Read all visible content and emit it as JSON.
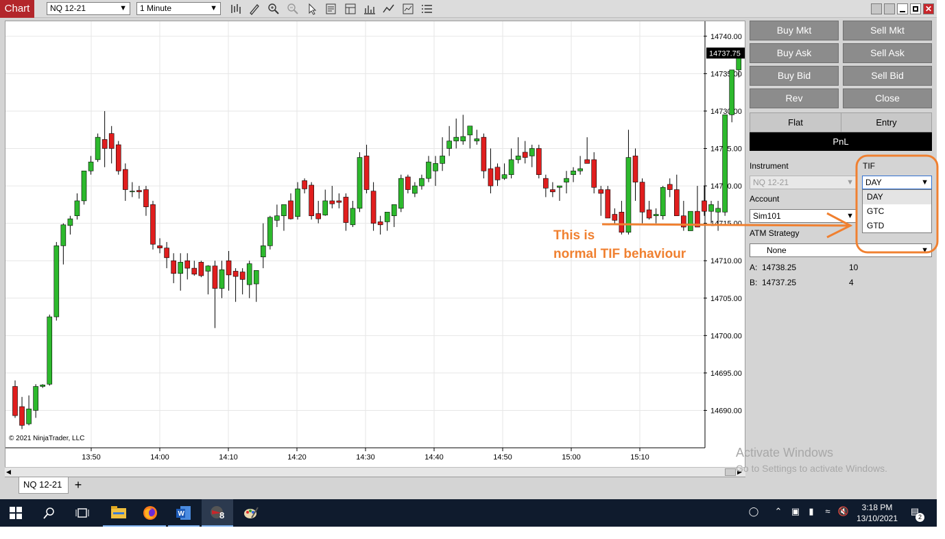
{
  "toolbar": {
    "tab_label": "Chart",
    "instrument": "NQ 12-21",
    "interval": "1 Minute",
    "icons": [
      "bar-type-icon",
      "drawing-tool-icon",
      "zoom-in-icon",
      "zoom-out-icon",
      "pointer-icon",
      "data-box-icon",
      "properties-icon",
      "chart-trader-icon",
      "indicators-icon",
      "strategies-icon",
      "menu-icon"
    ]
  },
  "chart_data": {
    "type": "candlestick",
    "instrument": "NQ 12-21",
    "price_ticks": [
      "14740.00",
      "14735.00",
      "14730.00",
      "14725.00",
      "14720.00",
      "14715.00",
      "14710.00",
      "14705.00",
      "14700.00",
      "14695.00",
      "14690.00"
    ],
    "time_ticks": [
      "13:50",
      "14:00",
      "14:10",
      "14:20",
      "14:30",
      "14:40",
      "14:50",
      "15:00",
      "15:10"
    ],
    "last_price": "14737.75",
    "ylim": [
      14685,
      14742
    ],
    "up_color": "#2db92d",
    "down_color": "#e01e1e",
    "grid": true,
    "candles": [
      [
        14693.2,
        14694.0,
        14689.0,
        14689.3
      ],
      [
        14690.5,
        14691.8,
        14687.5,
        14688.0
      ],
      [
        14688.2,
        14692.0,
        14688.0,
        14690.2
      ],
      [
        14690.0,
        14693.5,
        14689.0,
        14693.2
      ],
      [
        14693.2,
        14693.5,
        14693.0,
        14693.4
      ],
      [
        14693.5,
        14702.8,
        14693.3,
        14702.5
      ],
      [
        14702.5,
        14712.5,
        14702.0,
        14712.0
      ],
      [
        14712.0,
        14715.0,
        14709.5,
        14714.8
      ],
      [
        14714.7,
        14716.0,
        14713.5,
        14715.6
      ],
      [
        14716.0,
        14719.0,
        14715.5,
        14718.0
      ],
      [
        14718.0,
        14722.0,
        14717.5,
        14722.0
      ],
      [
        14722.0,
        14724.0,
        14721.5,
        14723.2
      ],
      [
        14723.5,
        14727.0,
        14723.2,
        14726.5
      ],
      [
        14726.2,
        14730.0,
        14722.5,
        14725.0
      ],
      [
        14727.0,
        14728.0,
        14723.0,
        14725.0
      ],
      [
        14725.5,
        14726.0,
        14721.5,
        14722.0
      ],
      [
        14722.2,
        14723.0,
        14718.0,
        14719.5
      ],
      [
        14719.2,
        14720.5,
        14718.5,
        14719.3
      ],
      [
        14719.4,
        14720.0,
        14718.3,
        14719.2
      ],
      [
        14719.5,
        14720.0,
        14716.0,
        14717.2
      ],
      [
        14717.5,
        14718.0,
        14711.5,
        14712.2
      ],
      [
        14712.0,
        14713.0,
        14711.0,
        14711.7
      ],
      [
        14711.7,
        14712.5,
        14709.0,
        14710.4
      ],
      [
        14710.0,
        14711.0,
        14707.0,
        14708.3
      ],
      [
        14708.3,
        14711.0,
        14706.0,
        14709.8
      ],
      [
        14710.0,
        14711.0,
        14707.5,
        14709.0
      ],
      [
        14709.0,
        14710.0,
        14708.0,
        14708.2
      ],
      [
        14709.8,
        14710.0,
        14707.8,
        14708.0
      ],
      [
        14708.6,
        14709.4,
        14705.5,
        14709.3
      ],
      [
        14709.3,
        14710.0,
        14701.0,
        14706.3
      ],
      [
        14706.3,
        14710.0,
        14705.0,
        14708.8
      ],
      [
        14710.0,
        14711.3,
        14706.0,
        14708.1
      ],
      [
        14708.6,
        14709.0,
        14704.5,
        14707.9
      ],
      [
        14708.5,
        14709.0,
        14705.5,
        14707.5
      ],
      [
        14706.8,
        14710.0,
        14705.0,
        14709.6
      ],
      [
        14706.9,
        14708.0,
        14704.5,
        14708.7
      ],
      [
        14710.5,
        14715.0,
        14709.0,
        14712.0
      ],
      [
        14712.0,
        14716.0,
        14711.5,
        14715.8
      ],
      [
        14715.4,
        14717.5,
        14714.5,
        14716.0
      ],
      [
        14716.0,
        14717.0,
        14714.0,
        14717.5
      ],
      [
        14718.0,
        14719.0,
        14715.5,
        14715.6
      ],
      [
        14715.9,
        14720.5,
        14715.5,
        14719.6
      ],
      [
        14720.7,
        14721.0,
        14719.0,
        14719.6
      ],
      [
        14720.1,
        14720.5,
        14715.5,
        14716.0
      ],
      [
        14716.3,
        14718.0,
        14715.0,
        14715.6
      ],
      [
        14716.1,
        14719.5,
        14716.0,
        14718.0
      ],
      [
        14718.0,
        14720.0,
        14717.0,
        14717.6
      ],
      [
        14718.0,
        14719.0,
        14717.0,
        14717.8
      ],
      [
        14718.5,
        14719.0,
        14714.0,
        14715.1
      ],
      [
        14714.8,
        14718.0,
        14714.5,
        14717.0
      ],
      [
        14717.0,
        14724.5,
        14716.5,
        14723.8
      ],
      [
        14724.0,
        14725.5,
        14719.0,
        14719.5
      ],
      [
        14719.3,
        14720.5,
        14714.0,
        14715.0
      ],
      [
        14715.2,
        14716.0,
        14713.5,
        14714.8
      ],
      [
        14715.2,
        14716.5,
        14714.0,
        14716.5
      ],
      [
        14716.0,
        14717.5,
        14714.5,
        14717.5
      ],
      [
        14717.0,
        14721.5,
        14716.5,
        14721.0
      ],
      [
        14721.2,
        14721.5,
        14719.0,
        14719.5
      ],
      [
        14719.0,
        14720.5,
        14718.5,
        14720.0
      ],
      [
        14720.0,
        14721.5,
        14719.5,
        14721.0
      ],
      [
        14721.0,
        14724.0,
        14720.5,
        14723.2
      ],
      [
        14722.0,
        14724.0,
        14720.0,
        14723.0
      ],
      [
        14723.0,
        14726.5,
        14722.0,
        14724.0
      ],
      [
        14725.0,
        14728.0,
        14724.0,
        14726.0
      ],
      [
        14726.0,
        14729.0,
        14725.0,
        14726.5
      ],
      [
        14726.0,
        14729.5,
        14725.5,
        14726.6
      ],
      [
        14726.8,
        14728.0,
        14725.0,
        14728.0
      ],
      [
        14726.0,
        14727.5,
        14725.5,
        14726.3
      ],
      [
        14726.5,
        14727.0,
        14721.0,
        14722.0
      ],
      [
        14722.3,
        14725.0,
        14719.0,
        14720.0
      ],
      [
        14722.5,
        14723.0,
        14720.0,
        14720.8
      ],
      [
        14721.0,
        14723.0,
        14720.8,
        14721.5
      ],
      [
        14721.5,
        14725.0,
        14721.0,
        14723.5
      ],
      [
        14723.5,
        14726.5,
        14723.0,
        14724.0
      ],
      [
        14724.5,
        14726.0,
        14723.0,
        14723.8
      ],
      [
        14724.0,
        14725.5,
        14722.5,
        14725.0
      ],
      [
        14725.0,
        14725.5,
        14721.0,
        14721.5
      ],
      [
        14721.0,
        14721.5,
        14718.5,
        14719.7
      ],
      [
        14719.5,
        14720.5,
        14718.5,
        14719.2
      ],
      [
        14719.8,
        14720.0,
        14718.0,
        14720.0
      ],
      [
        14720.5,
        14722.0,
        14719.0,
        14721.0
      ],
      [
        14721.5,
        14722.5,
        14720.5,
        14722.0
      ],
      [
        14722.0,
        14724.0,
        14721.5,
        14722.3
      ],
      [
        14723.5,
        14726.5,
        14723.0,
        14723.0
      ],
      [
        14723.5,
        14724.5,
        14719.0,
        14719.8
      ],
      [
        14719.5,
        14720.0,
        14716.0,
        14719.0
      ],
      [
        14719.5,
        14720.0,
        14717.0,
        14715.7
      ],
      [
        14716.2,
        14717.0,
        14715.0,
        14715.4
      ],
      [
        14716.5,
        14718.0,
        14713.5,
        14713.8
      ],
      [
        14713.8,
        14727.5,
        14713.5,
        14723.8
      ],
      [
        14724.0,
        14725.0,
        14718.0,
        14720.5
      ],
      [
        14720.5,
        14721.0,
        14715.0,
        14716.5
      ],
      [
        14716.8,
        14718.0,
        14715.5,
        14715.7
      ],
      [
        14716.0,
        14717.0,
        14715.0,
        14716.2
      ],
      [
        14716.0,
        14720.0,
        14715.5,
        14719.8
      ],
      [
        14720.2,
        14721.0,
        14718.5,
        14719.5
      ],
      [
        14719.5,
        14721.5,
        14716.0,
        14716.0
      ],
      [
        14716.0,
        14718.0,
        14714.0,
        14714.5
      ],
      [
        14714.0,
        14716.5,
        14714.0,
        14716.6
      ],
      [
        14716.6,
        14720.0,
        14716.0,
        14714.5
      ],
      [
        14718.0,
        14720.0,
        14716.0,
        14716.6
      ],
      [
        14716.6,
        14718.0,
        14715.0,
        14717.5
      ],
      [
        14716.5,
        14718.0,
        14714.0,
        14717.0
      ],
      [
        14716.5,
        14729.0,
        14716.0,
        14729.5
      ],
      [
        14729.5,
        14735.5,
        14728.5,
        14735.5
      ],
      [
        14735.5,
        14738.0,
        14734.5,
        14738.0
      ]
    ]
  },
  "chart_copyright": "© 2021 NinjaTrader, LLC",
  "bottom_tab": {
    "label": "NQ 12-21",
    "add_label": "+"
  },
  "order_buttons": {
    "buy_mkt": "Buy Mkt",
    "sell_mkt": "Sell Mkt",
    "buy_ask": "Buy Ask",
    "sell_ask": "Sell Ask",
    "buy_bid": "Buy Bid",
    "sell_bid": "Sell Bid",
    "rev": "Rev",
    "close": "Close"
  },
  "position": {
    "flat": "Flat",
    "entry": "Entry",
    "pnl": "PnL"
  },
  "instrument": {
    "label": "Instrument",
    "value": "NQ 12-21"
  },
  "tif": {
    "label": "TIF",
    "value": "DAY",
    "options": [
      "DAY",
      "GTC",
      "GTD"
    ]
  },
  "account": {
    "label": "Account",
    "value": "Sim101"
  },
  "atm": {
    "label": "ATM Strategy",
    "value": "None"
  },
  "quotes": {
    "ask_label": "A:",
    "ask_price": "14738.25",
    "ask_size": "10",
    "bid_label": "B:",
    "bid_price": "14737.25",
    "bid_size": "4"
  },
  "annotation": {
    "line1": "This is",
    "line2": "normal TIF behaviour",
    "color": "#f08030"
  },
  "watermark": {
    "line1": "Activate Windows",
    "line2": "Go to Settings to activate Windows."
  },
  "taskbar": {
    "time": "3:18 PM",
    "date": "13/10/2021",
    "notification_count": "2",
    "ninjatrader_badge": "8"
  },
  "colors": {
    "chart_tab": "#b3262b",
    "button_gray": "#8c8c8c",
    "taskbar": "#0f1b2d"
  }
}
